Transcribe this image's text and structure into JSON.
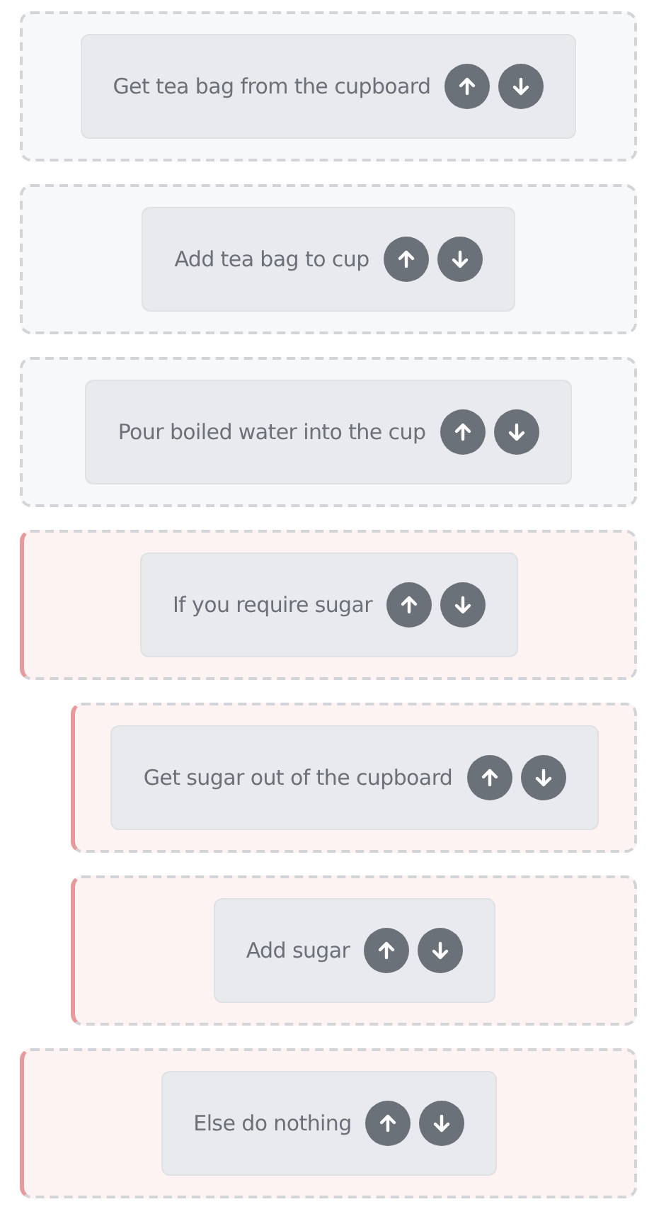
{
  "blocks": [
    {
      "kind": "step",
      "label": "Get tea bag from the cupboard"
    },
    {
      "kind": "step",
      "label": "Add tea bag to cup"
    },
    {
      "kind": "step",
      "label": "Pour boiled water into the cup"
    },
    {
      "kind": "condition",
      "label": "If you require sugar",
      "children": [
        {
          "kind": "condition",
          "label": "Get sugar out of the cupboard"
        },
        {
          "kind": "condition",
          "label": "Add sugar"
        }
      ]
    },
    {
      "kind": "condition",
      "label": "Else do nothing"
    }
  ]
}
